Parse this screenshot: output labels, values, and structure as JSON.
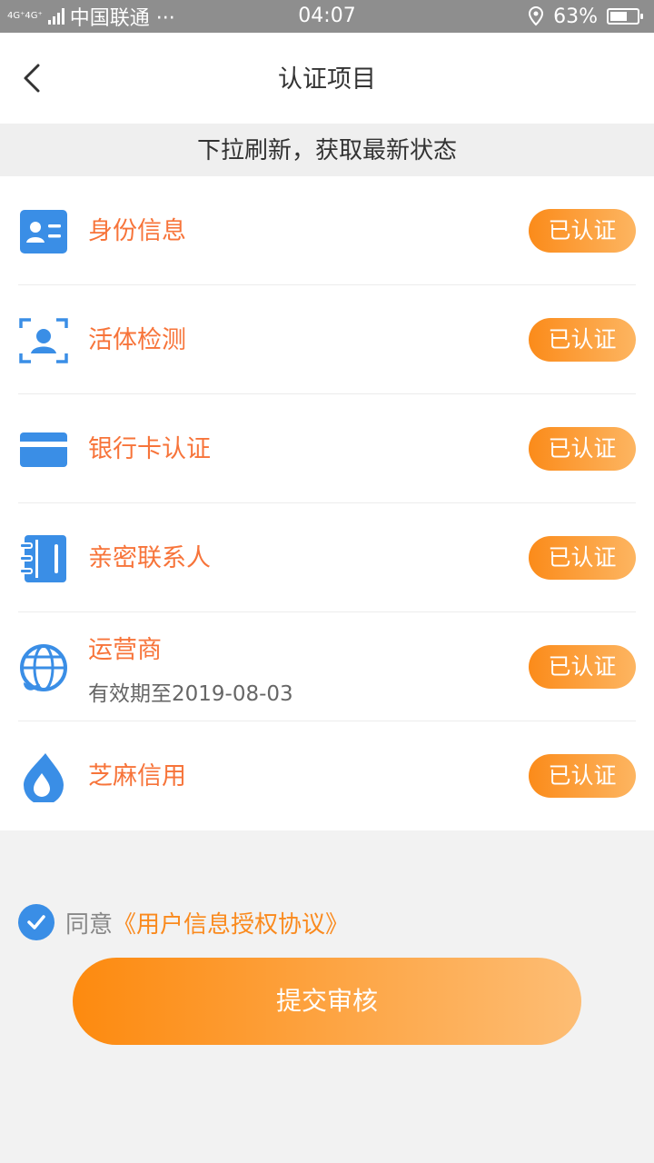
{
  "status_bar": {
    "network": "4G⁺4G⁺",
    "carrier": "中国联通 ···",
    "time": "04:07",
    "battery": "63%",
    "battery_level": 0.63
  },
  "header": {
    "title": "认证项目",
    "back_icon": "chevron-left-icon"
  },
  "tip": "下拉刷新，获取最新状态",
  "items": [
    {
      "label": "身份信息",
      "sub": "",
      "status": "已认证",
      "icon": "id-card-icon"
    },
    {
      "label": "活体检测",
      "sub": "",
      "status": "已认证",
      "icon": "face-scan-icon"
    },
    {
      "label": "银行卡认证",
      "sub": "",
      "status": "已认证",
      "icon": "bank-card-icon"
    },
    {
      "label": "亲密联系人",
      "sub": "",
      "status": "已认证",
      "icon": "contacts-book-icon"
    },
    {
      "label": "运营商",
      "sub": "有效期至2019-08-03",
      "status": "已认证",
      "icon": "globe-icon"
    },
    {
      "label": "芝麻信用",
      "sub": "",
      "status": "已认证",
      "icon": "sesame-drop-icon"
    }
  ],
  "agreement": {
    "text": "同意",
    "link": "《用户信息授权协议》",
    "checked": true
  },
  "submit_label": "提交审核",
  "colors": {
    "accent": "#fa8a1e",
    "label": "#f7743a",
    "icon_blue": "#3a8ee6"
  }
}
